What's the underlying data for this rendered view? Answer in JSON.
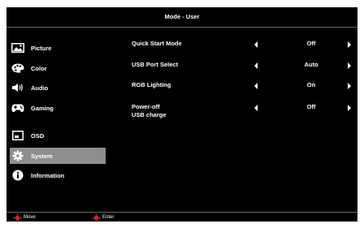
{
  "header": {
    "title": "Mode - User"
  },
  "sidebar": {
    "items": [
      {
        "label": "Picture",
        "icon": "picture-icon",
        "selected": false
      },
      {
        "label": "Color",
        "icon": "palette-icon",
        "selected": false
      },
      {
        "label": "Audio",
        "icon": "speaker-icon",
        "selected": false
      },
      {
        "label": "Gaming",
        "icon": "gamepad-icon",
        "selected": false
      },
      {
        "label": "OSD",
        "icon": "osd-icon",
        "selected": false
      },
      {
        "label": "System",
        "icon": "gear-icon",
        "selected": true
      },
      {
        "label": "Information",
        "icon": "info-icon",
        "selected": false
      }
    ]
  },
  "settings": {
    "rows": [
      {
        "label": "Quick Start Mode",
        "value": "Off"
      },
      {
        "label": "USB Port Select",
        "value": "Auto"
      },
      {
        "label": "RGB Lighting",
        "value": "On"
      },
      {
        "label_line1": "Power-off",
        "label_line2": "USB charge",
        "value": "Off"
      }
    ]
  },
  "footer": {
    "move_label": "Move",
    "enter_label": "Enter"
  },
  "colors": {
    "background": "#000000",
    "text": "#ffffff",
    "selected": "#8e8e8e",
    "dpad": "#d0202a"
  }
}
